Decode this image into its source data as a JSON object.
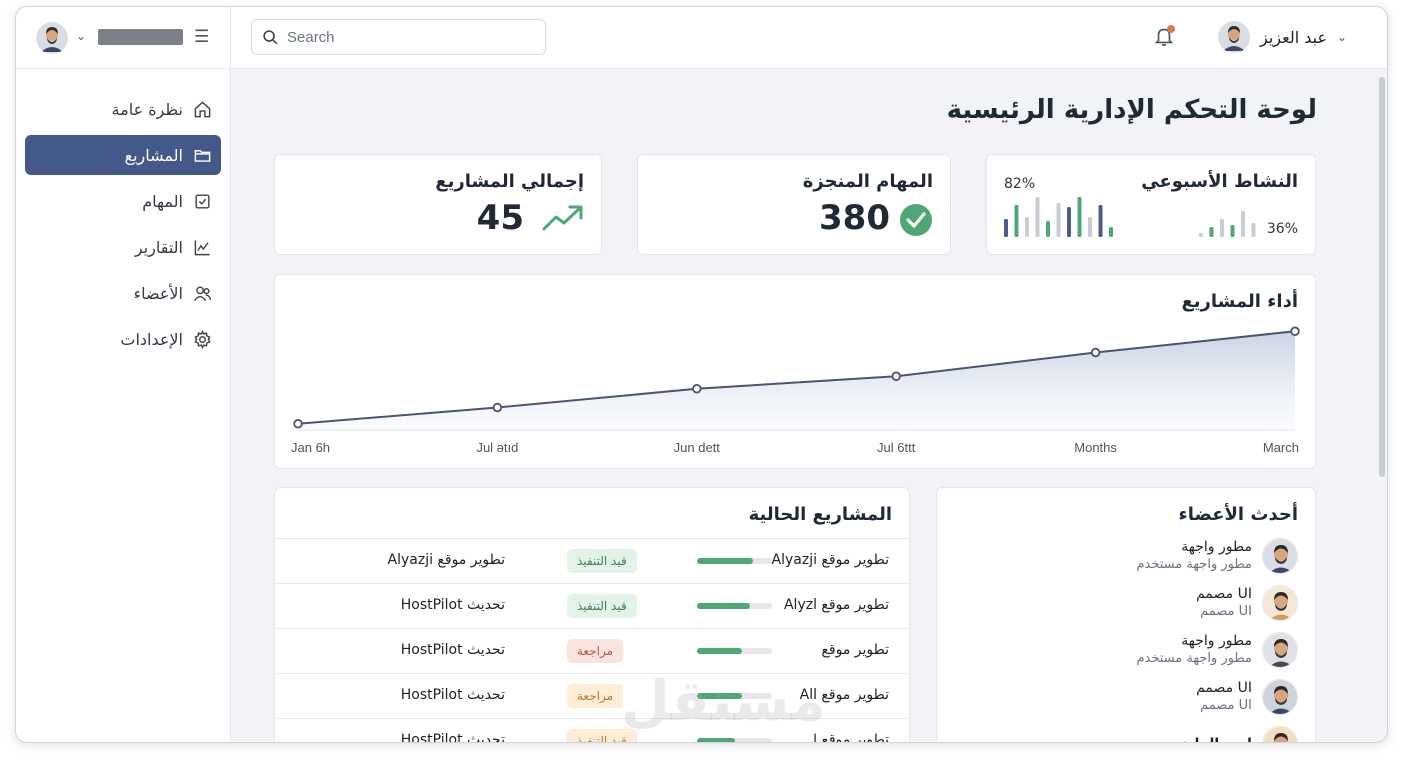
{
  "header": {
    "search_placeholder": "Search",
    "user_name": "عبد العزيز",
    "notification_dot_color": "#e07a45"
  },
  "sidebar": {
    "items": [
      {
        "label": "نظرة عامة",
        "icon": "home-icon",
        "active": false
      },
      {
        "label": "المشاريع",
        "icon": "folder-icon",
        "active": true
      },
      {
        "label": "المهام",
        "icon": "checkbox-icon",
        "active": false
      },
      {
        "label": "التقارير",
        "icon": "chart-line-icon",
        "active": false
      },
      {
        "label": "الأعضاء",
        "icon": "users-icon",
        "active": false
      },
      {
        "label": "الإعدادات",
        "icon": "gear-icon",
        "active": false
      }
    ],
    "active_color": "#44598a"
  },
  "page": {
    "title": "لوحة التحكم الإدارية الرئيسية"
  },
  "stats": {
    "total_projects": {
      "label": "إجمالي المشاريع",
      "value": "45"
    },
    "completed_tasks": {
      "label": "المهام المنجزة",
      "value": "380"
    },
    "weekly_activity": {
      "label": "النشاط الأسبوعي",
      "pct_high": "82%",
      "pct_low": "36%",
      "bars_left": [
        0.45,
        0.8,
        0.5,
        1.0,
        0.4,
        0.85,
        0.75,
        1.0,
        0.5,
        0.8,
        0.25
      ],
      "bars_right": [
        0.1,
        0.25,
        0.45,
        0.3,
        0.65,
        0.35,
        0.85
      ]
    }
  },
  "performance": {
    "title": "أداء المشاريع",
    "x_labels": [
      "Jan 6h",
      "Jul ətıd",
      "Jun dett",
      "Jul 6ttt",
      "Months",
      "March"
    ]
  },
  "chart_data": {
    "type": "area",
    "title": "أداء المشاريع",
    "categories": [
      "Jan 6h",
      "Jul ətıd",
      "Jun dett",
      "Jul 6ttt",
      "Months",
      "March"
    ],
    "values": [
      5,
      18,
      33,
      43,
      62,
      79
    ],
    "ylim": [
      0,
      100
    ],
    "grid": false
  },
  "projects": {
    "title": "المشاريع الحالية",
    "rows": [
      {
        "name": "تطوير موقع Alyazji",
        "progress": 0.75,
        "status": "قيد التنفيذ",
        "status_bg": "#e3f3e8",
        "status_fg": "#3e7e56",
        "title": "تطوير موقع Alyazji"
      },
      {
        "name": "تطوير موقع Alyzl",
        "progress": 0.7,
        "status": "قيد التنفيذ",
        "status_bg": "#e3f3e8",
        "status_fg": "#3e7e56",
        "title": "تحديث HostPilot"
      },
      {
        "name": "تطوير موقع",
        "progress": 0.6,
        "status": "مراجعة",
        "status_bg": "#fbe3e0",
        "status_fg": "#b4544a",
        "title": "تحديث HostPilot"
      },
      {
        "name": "تطوير موقع All",
        "progress": 0.6,
        "status": "مراجعة",
        "status_bg": "#fdecd6",
        "status_fg": "#b87a2e",
        "title": "تحديث HostPilot"
      },
      {
        "name": "تطوير موقع ا",
        "progress": 0.5,
        "status": "قيد التنفيذ",
        "status_bg": "#fdecd6",
        "status_fg": "#b87a2e",
        "title": "تحديث HostPilot"
      }
    ]
  },
  "members": {
    "title": "أحدث الأعضاء",
    "rows": [
      {
        "name": "مطور واجهة",
        "role": "مطور واجهة مستخدم",
        "bold": false
      },
      {
        "name": "مصمم UI",
        "role": "مصمم UI",
        "bold": false
      },
      {
        "name": "مطور واجهة",
        "role": "مطور واجهة مستخدم",
        "bold": false
      },
      {
        "name": "مصمم UI",
        "role": "مصمم UI",
        "bold": false
      },
      {
        "name": "امير المليز",
        "role": "",
        "bold": true
      }
    ]
  },
  "watermark": "مستقل"
}
